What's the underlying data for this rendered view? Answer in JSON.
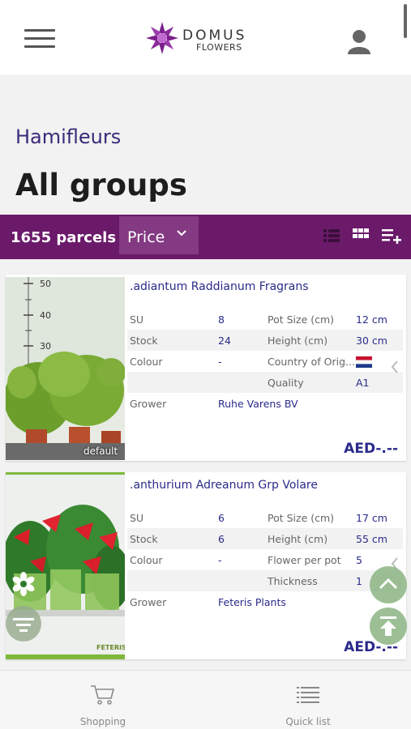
{
  "header": {
    "logo_word": "DOMUS",
    "logo_sub": "FLOWERS"
  },
  "page": {
    "brand": "Hamifleurs",
    "title": "All groups"
  },
  "toolbar": {
    "parcels": "1655 parcels",
    "sort_label": "Price"
  },
  "products": [
    {
      "name": ".adiantum Raddianum Fragrans",
      "image_label": "default",
      "rows": [
        {
          "l1": "SU",
          "v1": "8",
          "l2": "Pot Size (cm)",
          "v2": "12 cm"
        },
        {
          "l1": "Stock",
          "v1": "24",
          "l2": "Height (cm)",
          "v2": "30 cm"
        },
        {
          "l1": "Colour",
          "v1": "-",
          "l2": "Country of Orig...",
          "v2": ""
        },
        {
          "l1": "",
          "v1": "",
          "l2": "Quality",
          "v2": "A1"
        },
        {
          "l1": "Grower",
          "v1": "Ruhe Varens BV",
          "l2": "",
          "v2": ""
        }
      ],
      "price": "AED-.--",
      "ruler_marks": [
        "50",
        "40",
        "30"
      ]
    },
    {
      "name": ".anthurium Adreanum Grp Volare",
      "rows": [
        {
          "l1": "SU",
          "v1": "6",
          "l2": "Pot Size (cm)",
          "v2": "17 cm"
        },
        {
          "l1": "Stock",
          "v1": "6",
          "l2": "Height (cm)",
          "v2": "55 cm"
        },
        {
          "l1": "Colour",
          "v1": "-",
          "l2": "Flower per pot",
          "v2": "5"
        },
        {
          "l1": "",
          "v1": "",
          "l2": "Thickness",
          "v2": "1"
        },
        {
          "l1": "Grower",
          "v1": "Feteris Plants",
          "l2": "",
          "v2": ""
        }
      ],
      "price": "AED-.--",
      "tag": "FETERIS"
    }
  ],
  "bottom_nav": {
    "shopping": "Shopping",
    "quick_list": "Quick list"
  },
  "colors": {
    "toolbar": "#6b1a6a",
    "accent_text": "#2a2a8a",
    "brand": "#3b2a7a"
  }
}
